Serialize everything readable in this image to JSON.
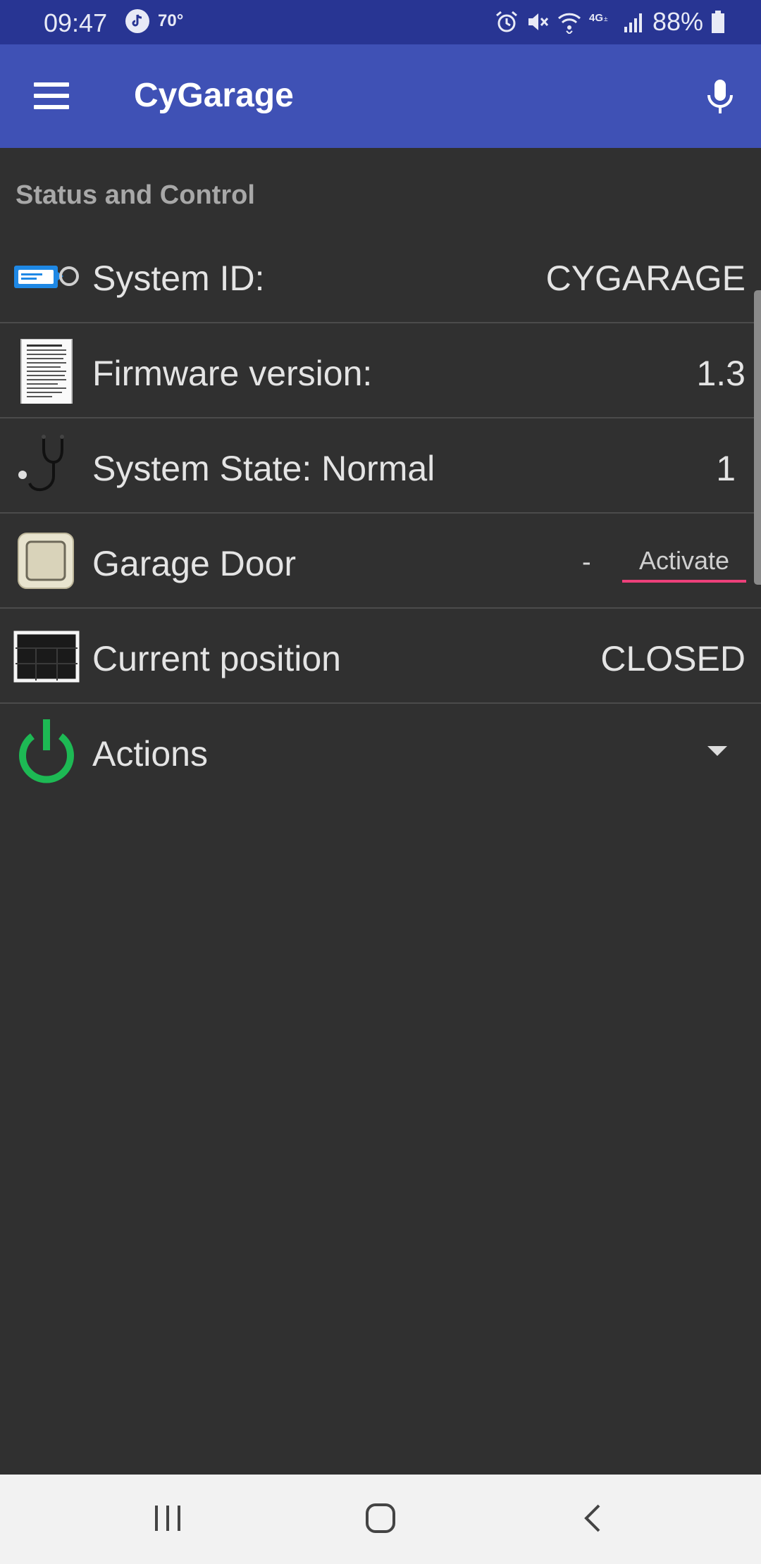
{
  "status_bar": {
    "time": "09:47",
    "temperature": "70°",
    "battery": "88%",
    "icons": [
      "tiktok-icon",
      "alarm-icon",
      "mute-icon",
      "wifi-icon",
      "4g-icon",
      "signal-icon",
      "battery-icon"
    ]
  },
  "app_bar": {
    "title": "CyGarage",
    "icons": [
      "menu-icon",
      "mic-icon"
    ]
  },
  "section": {
    "title": "Status and Control"
  },
  "rows": [
    {
      "label": "System ID:",
      "value": "CYGARAGE",
      "icon": "id-tag-icon"
    },
    {
      "label": "Firmware version:",
      "value": "1.3",
      "icon": "document-icon"
    },
    {
      "label": "System State: Normal",
      "value": "1",
      "icon": "stethoscope-icon"
    },
    {
      "label": "Garage Door",
      "value": "-",
      "button": "Activate",
      "icon": "switch-icon"
    },
    {
      "label": "Current position",
      "value": "CLOSED",
      "icon": "garage-door-icon"
    },
    {
      "label": "Actions",
      "icon": "power-icon"
    }
  ],
  "colors": {
    "status_bar": "#283593",
    "app_bar": "#3f51b5",
    "background": "#303030",
    "accent": "#ec407a",
    "power_green": "#1db954"
  }
}
